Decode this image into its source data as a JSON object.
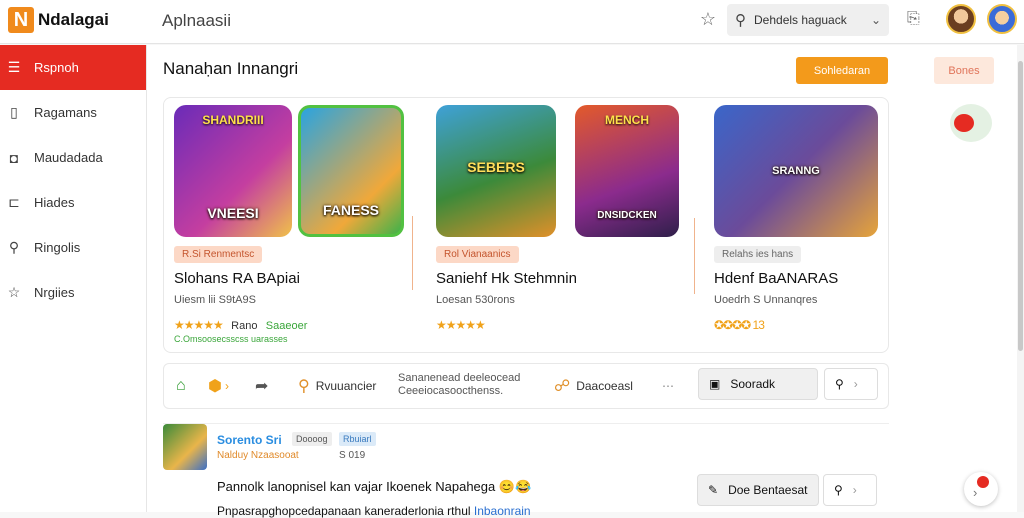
{
  "app": {
    "logo_mark": "N",
    "logo_text": "Ndalagai",
    "window_title": "Aplnaasii"
  },
  "header": {
    "search_text": "Dehdels haguack",
    "icons": [
      "star-icon",
      "search-icon",
      "chevron-down-icon",
      "share-icon"
    ]
  },
  "sidebar": {
    "items": [
      {
        "label": "Rspnoh",
        "icon": "list-icon",
        "active": true
      },
      {
        "label": "Ragamans",
        "icon": "file-icon"
      },
      {
        "label": "Maudadada",
        "icon": "monitor-icon"
      },
      {
        "label": "Hiades",
        "icon": "folder-icon"
      },
      {
        "label": "Ringolis",
        "icon": "search-icon"
      },
      {
        "label": "Nrgiies",
        "icon": "star-icon"
      }
    ]
  },
  "main": {
    "section_title": "Nanaḥan Innangri",
    "primary_button": "Sohledaran",
    "secondary_button": "Bones",
    "cards": [
      {
        "thumb_a_top": "SHANDRIII",
        "thumb_a_tag": "VNEESI",
        "thumb_b_tag": "FANESS",
        "pill": "R.Si Renmentsc",
        "title": "Slohans RA BApiai",
        "sub": "Uiesm lii S9tA9S",
        "stars": "★★★★★",
        "rating_label": "Rano",
        "rating_note": "Saaeoer",
        "meta": "C.Omsoosecsscss uarasses"
      },
      {
        "thumb_a_tag": "SEBERS",
        "thumb_b_top": "MENCH",
        "thumb_b_tag": "DNSIDCKEN",
        "pill": "Rol Vianaanics",
        "title": "Saniehf Hk Stehmnin",
        "sub": "Loesan 530rons",
        "stars": "★★★★★"
      },
      {
        "thumb_tag": "SRANNG",
        "pill": "Relahs ies hans",
        "title": "Hdenf BaANARAS",
        "sub": "Uoedrh S Unnanqres",
        "stars": "✪✪✪✪ 13"
      }
    ],
    "actions": {
      "home_icon": "home-icon",
      "badge_icon": "badge-icon",
      "share_icon": "share-icon",
      "reviewer_label": "Rvuuancier",
      "description_line1": "Sananenead deeleocead",
      "description_line2": "Ceeeiocasoocthenss.",
      "link_label": "Daacoeasl",
      "more": "⋯",
      "button_label": "Sooradk"
    },
    "post": {
      "name": "Sorento Sri",
      "tag_a": "Doooog",
      "tag_b": "Rbuiarl",
      "handle": "Nalduy Nzaasooat",
      "count": "S 019",
      "body": "Pannolk lanopnisel kan vajar Ikoenek Napahega 😊😂",
      "body2_prefix": "Pnpasrapghopcedapanaan kaneraderlonia rthul ",
      "body2_link": "Inbaonrain",
      "button_label": "Doe Bentaesat"
    }
  }
}
